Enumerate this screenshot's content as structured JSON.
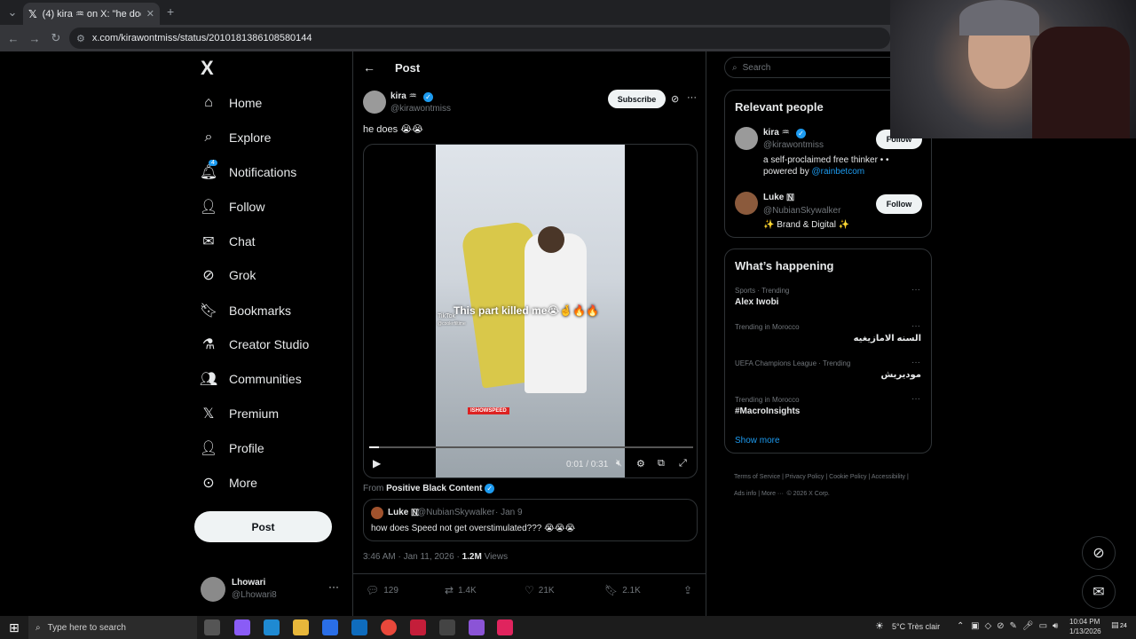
{
  "browser": {
    "tab_title": "(4) kira ♒ on X: \"he does 😭😭",
    "url": "x.com/kirawontmiss/status/2010181386108580144",
    "new_tab": "+"
  },
  "sidebar": {
    "logo": "X",
    "items": [
      {
        "label": "Home",
        "icon": "home-icon"
      },
      {
        "label": "Explore",
        "icon": "search-icon"
      },
      {
        "label": "Notifications",
        "icon": "bell-icon",
        "badge": "4"
      },
      {
        "label": "Follow",
        "icon": "person-plus-icon"
      },
      {
        "label": "Chat",
        "icon": "mail-icon"
      },
      {
        "label": "Grok",
        "icon": "grok-icon"
      },
      {
        "label": "Bookmarks",
        "icon": "bookmark-icon"
      },
      {
        "label": "Creator Studio",
        "icon": "flask-icon"
      },
      {
        "label": "Communities",
        "icon": "people-icon"
      },
      {
        "label": "Premium",
        "icon": "x-icon"
      },
      {
        "label": "Profile",
        "icon": "person-icon"
      },
      {
        "label": "More",
        "icon": "more-circle-icon"
      }
    ],
    "post_button": "Post",
    "account": {
      "name": "Lhowari",
      "handle": "@Lhowari8"
    }
  },
  "main": {
    "header": "Post",
    "post": {
      "author": "kira ♒",
      "handle": "@kirawontmiss",
      "subscribe": "Subscribe",
      "text": "he does 😭😭",
      "video": {
        "caption": "This part killed me😭🤞🔥🔥",
        "watermark": "TikTok",
        "watermark_handle": "@coolerfiltime",
        "brand": "ISHOWSPEED",
        "time": "0:01 / 0:31",
        "progress": 0.03
      },
      "from_label": "From",
      "from_source": "Positive Black Content",
      "quote": {
        "name": "Luke 🇳",
        "handle": "@NubianSkywalker",
        "date": "· Jan 9",
        "text": "how does Speed not get overstimulated??? 😭😭😭"
      },
      "timestamp": "3:46 AM · Jan 11, 2026 ·",
      "views_count": "1.2M",
      "views_label": "Views",
      "stats": {
        "replies": "129",
        "reposts": "1.4K",
        "likes": "21K",
        "bookmarks": "2.1K"
      }
    }
  },
  "right": {
    "search_placeholder": "Search",
    "relevant_title": "Relevant people",
    "people": [
      {
        "name": "kira ♒",
        "handle": "@kirawontmiss",
        "bio": "a self-proclaimed free thinker • •",
        "bio2_prefix": "powered by ",
        "bio2_link": "@rainbetcom",
        "button": "Follow"
      },
      {
        "name": "Luke 🇳",
        "handle": "@NubianSkywalker",
        "bio": "✨ Brand & Digital ✨",
        "button": "Follow"
      }
    ],
    "happening_title": "What’s happening",
    "trends": [
      {
        "meta": "Sports · Trending",
        "name": "Alex Iwobi"
      },
      {
        "meta": "Trending in Morocco",
        "name": "السنه الامازيغيه"
      },
      {
        "meta": "UEFA Champions League · Trending",
        "name": "موديريش"
      },
      {
        "meta": "Trending in Morocco",
        "name": "#MacroInsights"
      }
    ],
    "show_more": "Show more",
    "footer": [
      "Terms of Service",
      "Privacy Policy",
      "Cookie Policy",
      "Accessibility",
      "Ads info",
      "More ···",
      "© 2026 X Corp."
    ]
  },
  "taskbar": {
    "search_placeholder": "Type here to search",
    "weather": "5°C  Très clair",
    "time": "10:04 PM",
    "date": "1/13/2026",
    "notif_count": "24"
  }
}
